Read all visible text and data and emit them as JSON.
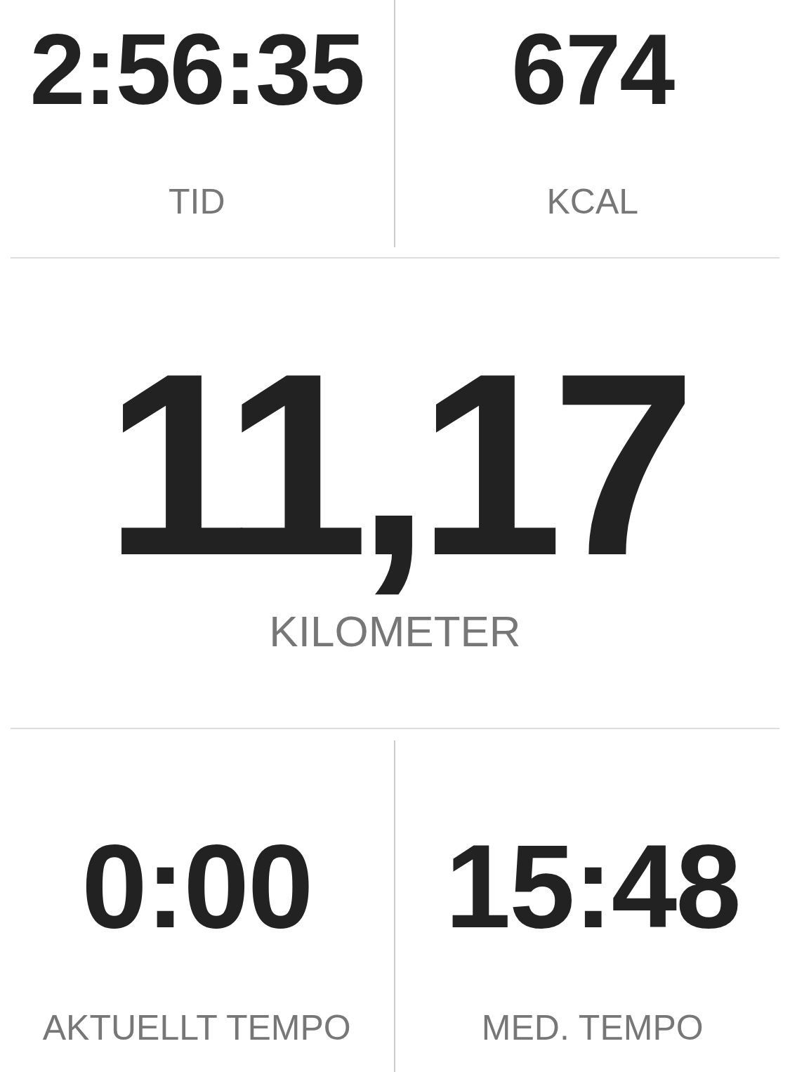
{
  "top_stats": [
    {
      "value": "2:56:35",
      "label": "TID"
    },
    {
      "value": "674",
      "label": "KCAL"
    }
  ],
  "main_stat": {
    "value": "11,17",
    "label": "KILOMETER"
  },
  "bottom_stats": [
    {
      "value": "0:00",
      "label": "AKTUELLT TEMPO"
    },
    {
      "value": "15:48",
      "label": "MED. TEMPO"
    }
  ]
}
